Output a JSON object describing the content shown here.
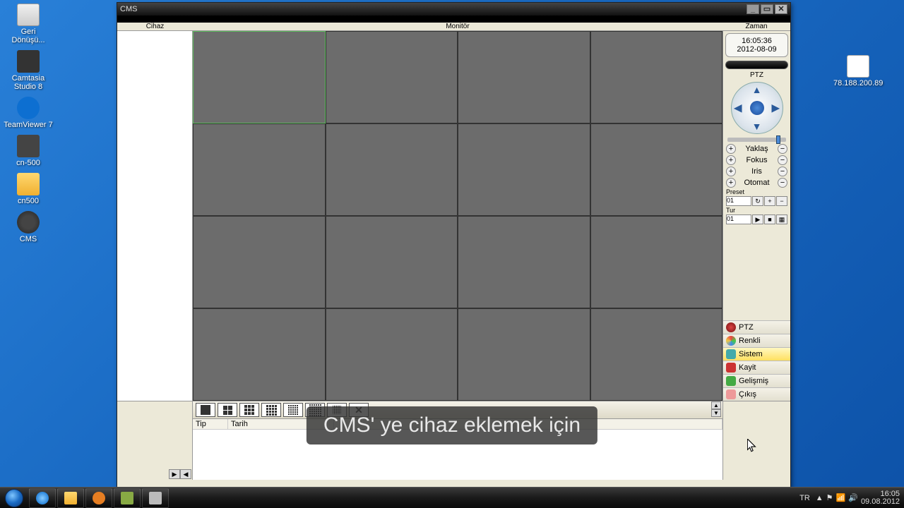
{
  "desktop": {
    "icons": [
      {
        "name": "recycle-bin",
        "label": "Geri Dönüşü..."
      },
      {
        "name": "camtasia-studio",
        "label": "Camtasia Studio 8"
      },
      {
        "name": "teamviewer",
        "label": "TeamViewer 7"
      },
      {
        "name": "cn500",
        "label": "cn-500"
      },
      {
        "name": "cn500-folder",
        "label": "cn500"
      },
      {
        "name": "cms",
        "label": "CMS"
      }
    ],
    "right_icon_label": "78.188.200.89"
  },
  "app": {
    "title": "CMS",
    "columns": {
      "left": "Cihaz",
      "mid": "Monitör",
      "right": "Zaman"
    },
    "clock": {
      "time": "16:05:36",
      "date": "2012-08-09"
    },
    "ptz": {
      "title": "PTZ",
      "controls": [
        {
          "label": "Yaklaş"
        },
        {
          "label": "Fokus"
        },
        {
          "label": "Iris"
        },
        {
          "label": "Otomat"
        }
      ],
      "preset_label": "Preset",
      "preset_value": "01",
      "tur_label": "Tur",
      "tur_value": "01"
    },
    "accordion": [
      {
        "label": "PTZ",
        "icon": "i-ptz"
      },
      {
        "label": "Renkli",
        "icon": "i-renkli"
      },
      {
        "label": "Sistem",
        "icon": "i-sistem",
        "selected": true
      },
      {
        "label": "Kayit",
        "icon": "i-kayit"
      },
      {
        "label": "Gelişmiş",
        "icon": "i-gelismis"
      },
      {
        "label": "Çıkış",
        "icon": "i-cikis"
      }
    ],
    "log_headers": {
      "c1": "Tip",
      "c2": "Tarih",
      "c3": ""
    }
  },
  "caption": "CMS' ye cihaz eklemek için",
  "taskbar": {
    "lang": "TR",
    "time": "16:05",
    "date": "09.08.2012"
  }
}
